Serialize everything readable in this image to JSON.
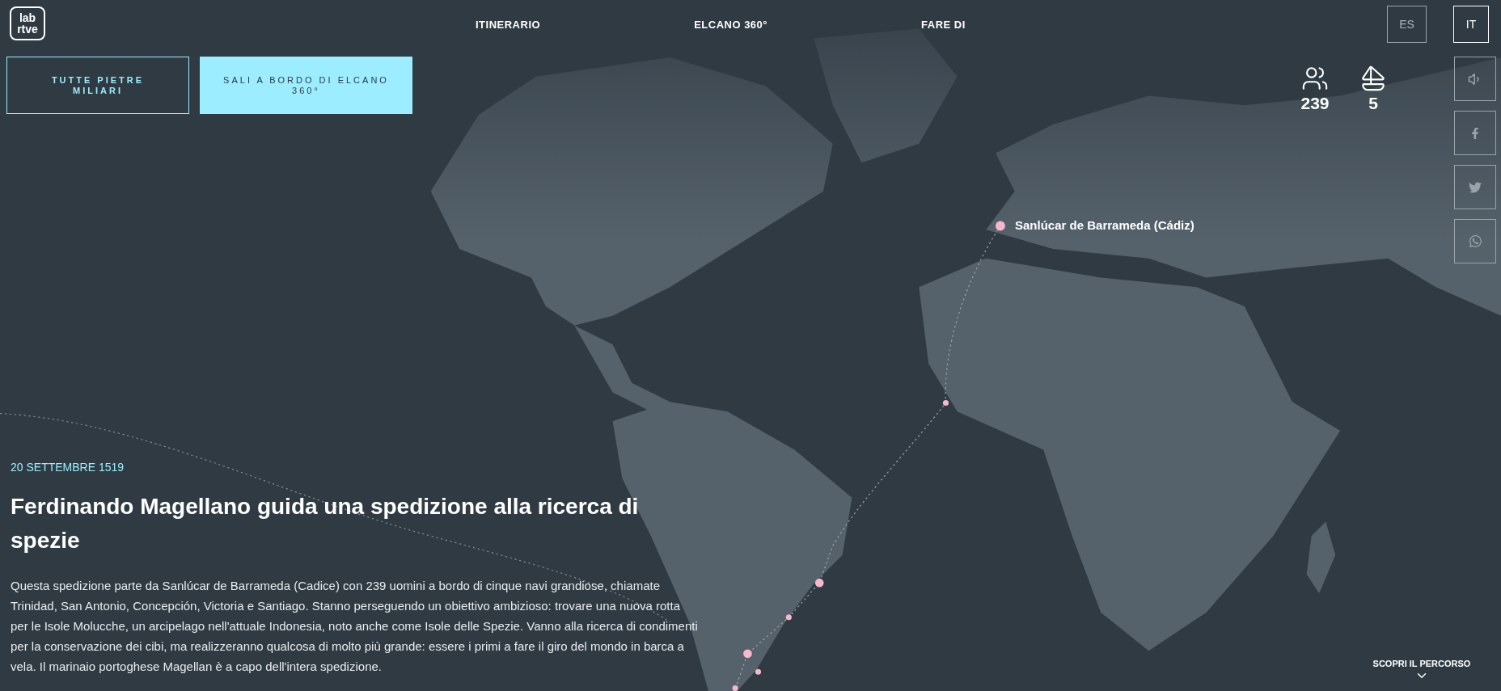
{
  "logo": {
    "line_1": "lab",
    "line_2": "rtve"
  },
  "nav": [
    {
      "label": "ITINERARIO"
    },
    {
      "label": "ELCANO 360°"
    },
    {
      "label": "FARE DI"
    }
  ],
  "languages": [
    {
      "label": "ES",
      "selected": false
    },
    {
      "label": "IT",
      "selected": true
    }
  ],
  "actions": [
    {
      "label": "TUTTE PIETRE MILIARI",
      "kind": "outline"
    },
    {
      "label": "SALI A BORDO DI ELCANO 360°",
      "kind": "filled"
    }
  ],
  "stats": [
    {
      "kind": "crew",
      "value": "239"
    },
    {
      "kind": "ships",
      "value": "5"
    }
  ],
  "share": [
    {
      "kind": "sound"
    },
    {
      "kind": "facebook"
    },
    {
      "kind": "twitter"
    },
    {
      "kind": "whatsapp"
    }
  ],
  "map": {
    "place_label": "Sanlúcar de Barrameda (Cádiz)"
  },
  "milestone": {
    "date": "20 SETTEMBRE 1519",
    "title": "Ferdinando Magellano guida una spedizione alla ricerca di spezie",
    "body": "Questa spedizione parte da Sanlúcar de Barrameda (Cadice) con 239 uomini a bordo di cinque navi grandiose, chiamate Trinidad, San Antonio, Concepción, Victoria e Santiago. Stanno perseguendo un obiettivo ambizioso: trovare una nuova rotta per le Isole Molucche, un arcipelago nell'attuale Indonesia, noto anche come Isole delle Spezie. Vanno alla ricerca di condimenti per la conservazione dei cibi, ma realizzeranno qualcosa di molto più grande: essere i primi a fare il giro del mondo in barca a vela. Il marinaio portoghese Magellan è a capo dell'intera spedizione."
  },
  "scroll_hint": {
    "label": "SCOPRI IL PERCORSO"
  }
}
